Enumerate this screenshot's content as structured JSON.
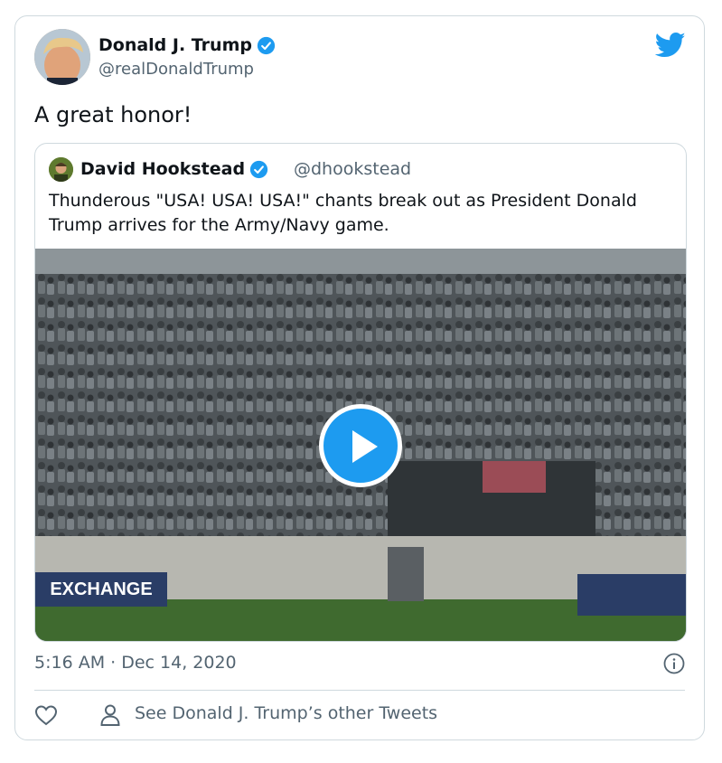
{
  "author": {
    "name": "Donald J. Trump",
    "handle": "@realDonaldTrump",
    "avatar_icon": "profile-photo",
    "verified_icon": "verified-badge-icon"
  },
  "tweet": {
    "text": "A great honor!",
    "timestamp": "5:16 AM · Dec 14, 2020"
  },
  "quoted_tweet": {
    "name": "David Hookstead",
    "handle": "@dhookstead",
    "text": "Thunderous \"USA! USA! USA!\" chants break out as President Donald Trump arrives for the Army/Navy game.",
    "media": {
      "type": "video",
      "sign_text": "EXCHANGE"
    }
  },
  "actions": {
    "see_other_tweets": "See Donald J. Trump’s other Tweets"
  },
  "colors": {
    "twitter_blue": "#1d9bf0",
    "secondary_text": "#536471",
    "border": "#cfd9de"
  }
}
